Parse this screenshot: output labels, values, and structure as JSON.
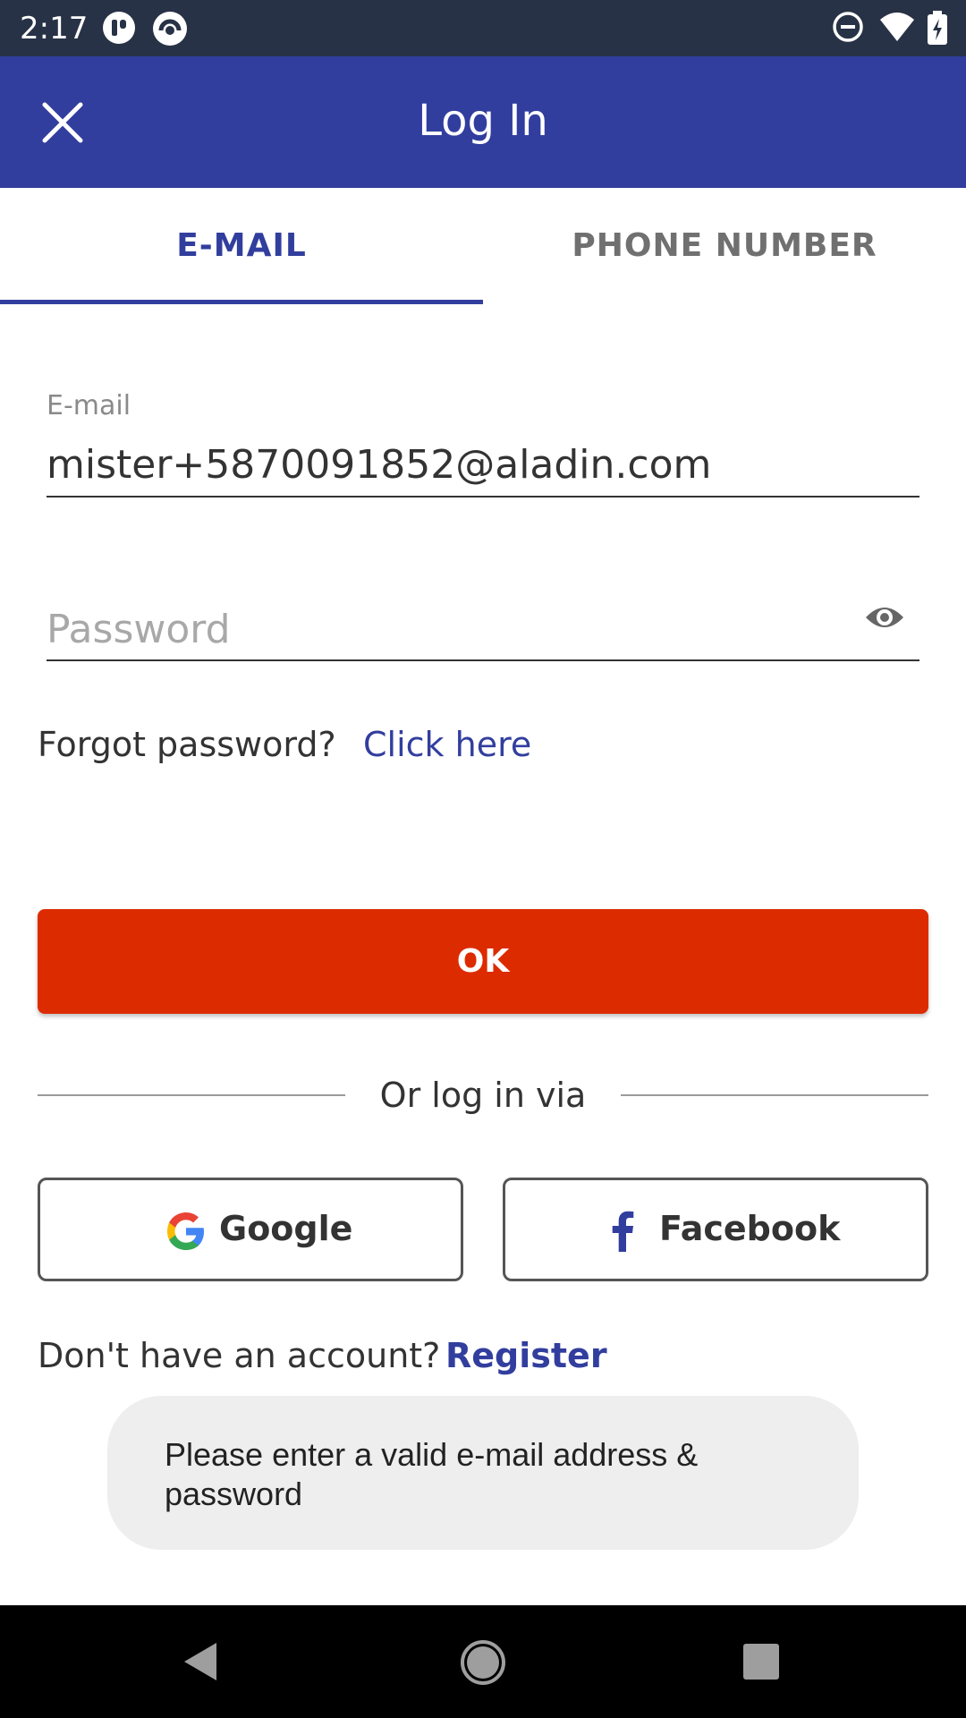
{
  "status_bar": {
    "time": "2:17",
    "icons": [
      "notification-app-icon",
      "notification-app-icon-2",
      "do-not-disturb-icon",
      "wifi-icon",
      "battery-charging-icon"
    ]
  },
  "app_bar": {
    "title": "Log In",
    "close_icon": "close-icon"
  },
  "tabs": [
    {
      "label": "E-MAIL",
      "active": true
    },
    {
      "label": "PHONE NUMBER",
      "active": false
    }
  ],
  "email_field": {
    "label": "E-mail",
    "value": "mister+5870091852@aladin.com"
  },
  "password_field": {
    "placeholder": "Password",
    "toggle_icon": "eye-icon"
  },
  "forgot": {
    "text": "Forgot password?",
    "link": "Click here"
  },
  "ok_button": {
    "label": "OK"
  },
  "divider": {
    "text": "Or log in via"
  },
  "social": {
    "google": "Google",
    "facebook": "Facebook"
  },
  "register_row": {
    "text": "Don't have an account?",
    "link": "Register"
  },
  "toast": {
    "message": "Please enter a valid e-mail address & password"
  },
  "nav_bar": {
    "icons": [
      "back-icon",
      "home-icon",
      "recents-icon"
    ]
  },
  "colors": {
    "primary": "#323e9e",
    "accent": "#dd2b00",
    "status_bar": "#283246"
  }
}
